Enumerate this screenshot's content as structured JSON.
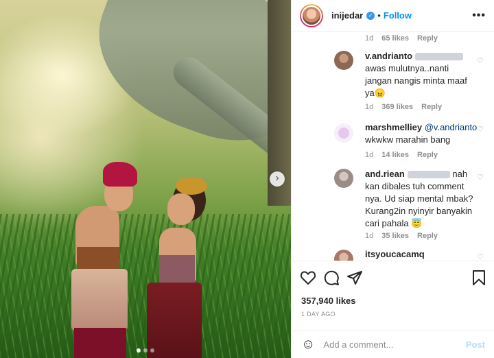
{
  "post": {
    "username": "inijedar",
    "follow_label": "Follow",
    "separator": "•",
    "more_icon": "•••",
    "likes": "357,940 likes",
    "time_ago": "1 DAY AGO",
    "next_icon": "›",
    "carousel_dots": 3,
    "carousel_active": 0
  },
  "first_meta": {
    "time": "1d",
    "likes": "65 likes",
    "reply": "Reply"
  },
  "comments": [
    {
      "username": "v.andrianto",
      "text": "awas mulutnya..nanti jangan nangis minta maaf ya😠",
      "time": "1d",
      "likes": "369 likes",
      "reply": "Reply"
    },
    {
      "username": "marshmelliey",
      "mention": "@v.andrianto",
      "text": "wkwkw marahin bang",
      "time": "1d",
      "likes": "14 likes",
      "reply": "Reply"
    },
    {
      "username": "and.riean",
      "text_inline": "nah",
      "text": "kan dibales tuh comment nya. Ud siap mental mbak? Kurang2in nyinyir banyakin cari pahala 😇",
      "time": "1d",
      "likes": "35 likes",
      "reply": "Reply"
    },
    {
      "username": "itsyoucacamq"
    }
  ],
  "add_comment": {
    "placeholder": "Add a comment...",
    "post_label": "Post",
    "emoji_icon": "☺"
  },
  "colors": {
    "accent": "#0095f6",
    "verified": "#3897f0",
    "post_disabled": "#b2dffc"
  },
  "icons": [
    "heart-icon",
    "comment-icon",
    "share-icon",
    "bookmark-icon",
    "verified-icon",
    "emoji-icon",
    "more-icon",
    "chevron-right-icon"
  ]
}
